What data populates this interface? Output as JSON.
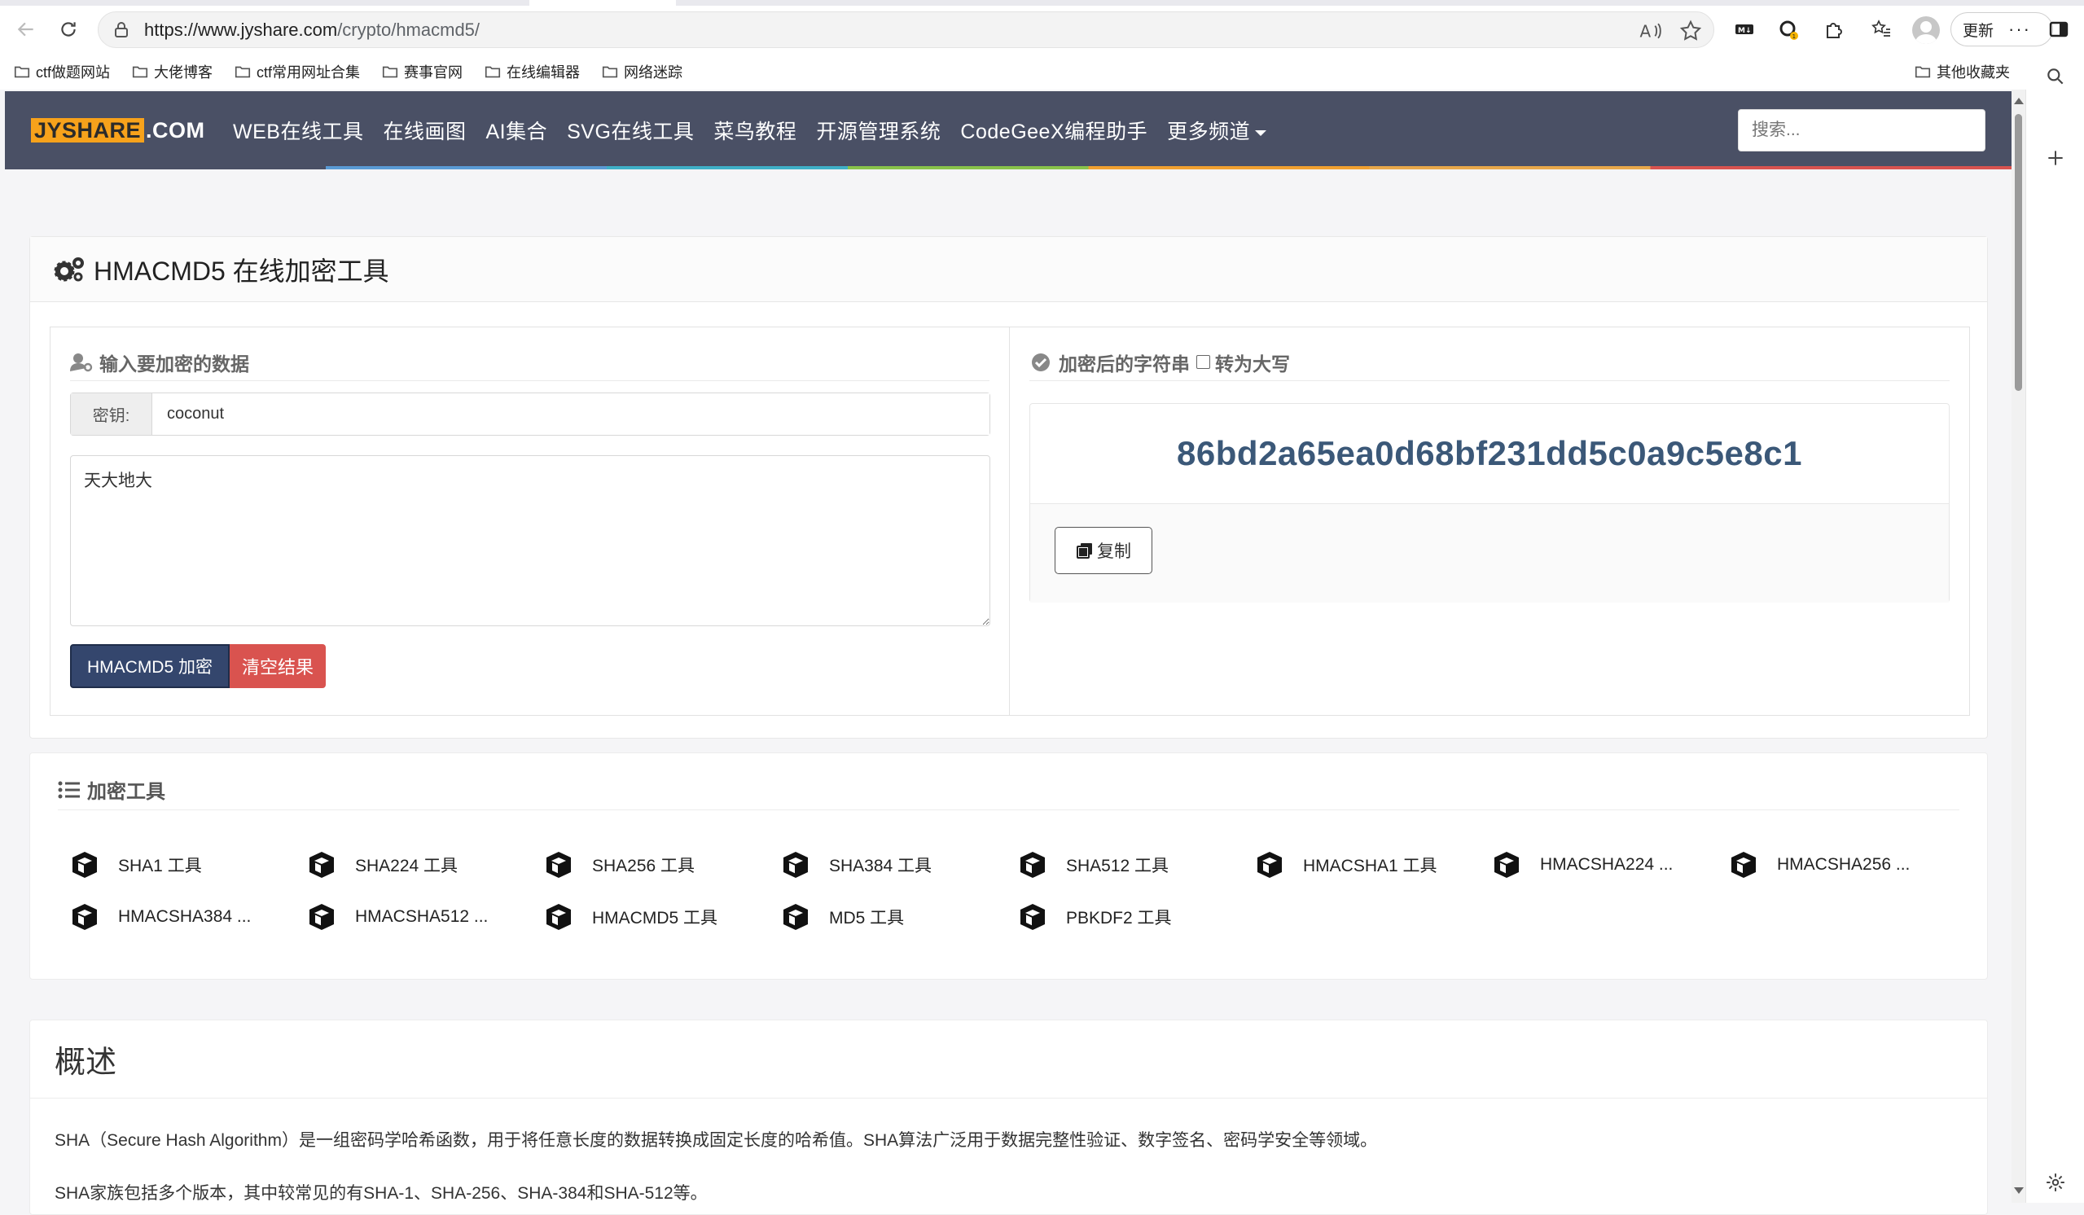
{
  "browser": {
    "url_host": "https://www.jyshare.com",
    "url_path": "/crypto/hmacmd5/",
    "update_label": "更新",
    "more_label": "···",
    "badge_count": "1",
    "bookmarks": [
      "ctf做题网站",
      "大佬博客",
      "ctf常用网址合集",
      "赛事官网",
      "在线编辑器",
      "网络迷踪"
    ],
    "bookmarks_other": "其他收藏夹"
  },
  "site": {
    "logo_box": "JYSHARE",
    "logo_com": ".COM",
    "nav": [
      "WEB在线工具",
      "在线画图",
      "AI集合",
      "SVG在线工具",
      "菜鸟教程",
      "开源管理系统",
      "CodeGeeX编程助手",
      "更多频道"
    ],
    "search_placeholder": "搜索..."
  },
  "tool": {
    "title": "HMACMD5 在线加密工具",
    "input_section": "输入要加密的数据",
    "key_label": "密钥:",
    "key_value": "coconut",
    "data_value": "天大地大",
    "encrypt_button": "HMACMD5 加密",
    "clear_button": "清空结果",
    "output_section": "加密后的字符串",
    "uppercase_label": "转为大写",
    "uppercase_checked": false,
    "result": "86bd2a65ea0d68bf231dd5c0a9c5e8c1",
    "copy_button": "复制"
  },
  "crypto_tools": {
    "title": "加密工具",
    "items": [
      "SHA1 工具",
      "SHA224 工具",
      "SHA256 工具",
      "SHA384 工具",
      "SHA512 工具",
      "HMACSHA1 工具",
      "HMACSHA224 ...",
      "HMACSHA256 ...",
      "HMACSHA384 ...",
      "HMACSHA512 ...",
      "HMACMD5 工具",
      "MD5 工具",
      "PBKDF2 工具"
    ]
  },
  "overview": {
    "title": "概述",
    "p1": "SHA（Secure Hash Algorithm）是一组密码学哈希函数，用于将任意长度的数据转换成固定长度的哈希值。SHA算法广泛用于数据完整性验证、数字签名、密码学安全等领域。",
    "p2": "SHA家族包括多个版本，其中较常见的有SHA-1、SHA-256、SHA-384和SHA-512等。"
  },
  "colors": {
    "navbar": "#4a5065",
    "logo_orange": "#f7a21b",
    "encrypt_button": "#34466d",
    "clear_button": "#d9534f",
    "hash_text": "#3b5878"
  }
}
